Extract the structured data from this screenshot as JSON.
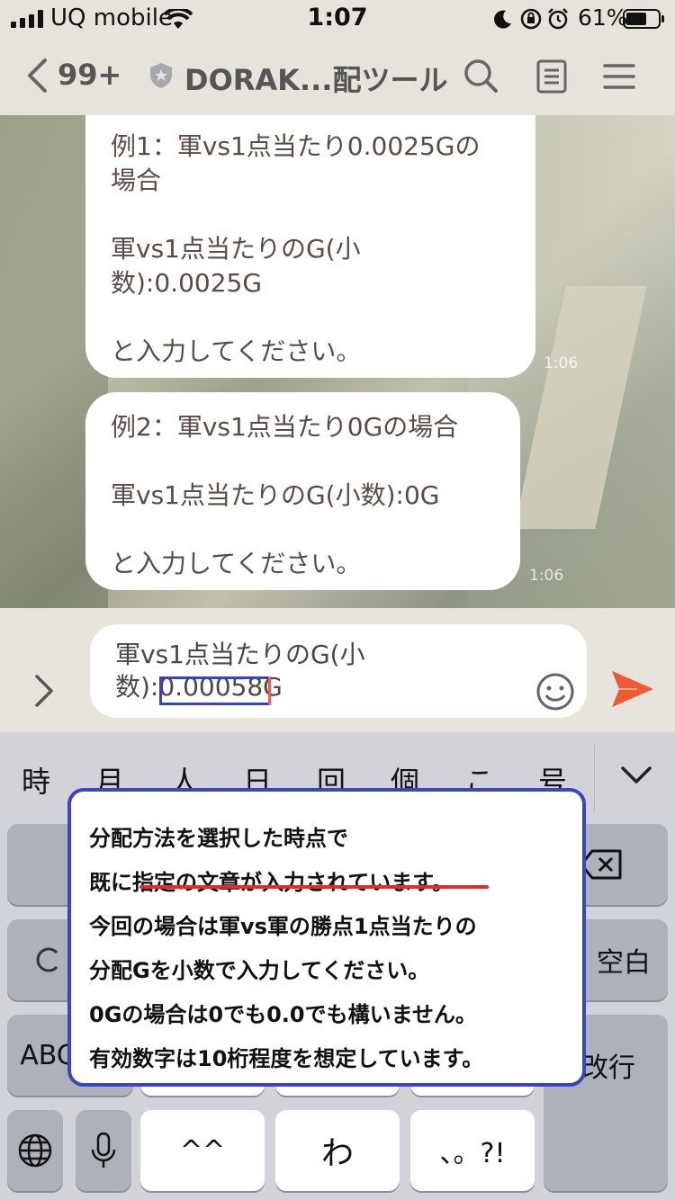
{
  "status_bar": {
    "carrier": "UQ mobile",
    "time": "1:07",
    "battery_percent": "61%"
  },
  "header": {
    "back_count": "99+",
    "title": "DORAK...配ツール"
  },
  "messages": [
    {
      "text": "例1：軍vs1点当たり0.0025Gの\n場合\n\n軍vs1点当たりのG(小\n数):0.0025G\n\nと入力してください。",
      "time": "1:06"
    },
    {
      "text": "例2：軍vs1点当たり0Gの場合\n\n軍vs1点当たりのG(小数):0G\n\nと入力してください。",
      "time": "1:06"
    }
  ],
  "input": {
    "value": "軍vs1点当たりのG(小\n数):0.00058G"
  },
  "keyboard": {
    "candidates": [
      "時",
      "月",
      "人",
      "日",
      "回",
      "個",
      "こ",
      "号"
    ],
    "keys": {
      "space": "空白",
      "return": "改行",
      "alpha": "ABC",
      "face": "^^",
      "wa": "わ",
      "punct": "、。?!"
    }
  },
  "annotation": {
    "lines": [
      "分配方法を選択した時点で",
      "既に指定の文章が入力されています。",
      "今回の場合は軍vs軍の勝点1点当たりの",
      "分配Gを小数で入力してください。",
      "0Gの場合は0でも0.0でも構いません。",
      "有効数字は10桁程度を想定しています。"
    ]
  },
  "colors": {
    "send": "#ef5a36",
    "annotation_border": "#3c44c4",
    "annotation_underline": "#e02a34"
  }
}
